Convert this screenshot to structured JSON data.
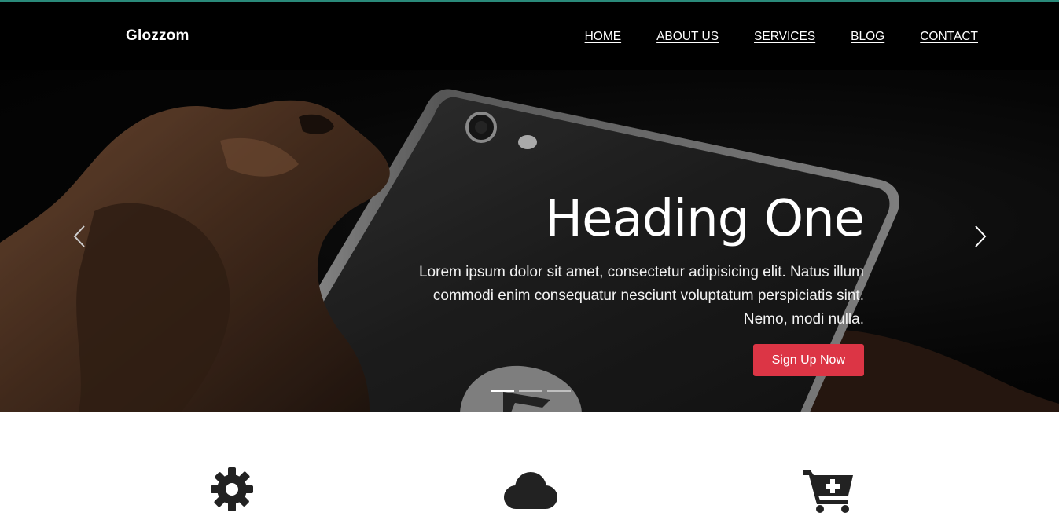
{
  "navbar": {
    "brand": "Glozzom",
    "links": [
      "HOME",
      "ABOUT US",
      "SERVICES",
      "BLOG",
      "CONTACT"
    ]
  },
  "hero": {
    "heading": "Heading One",
    "text_lines": [
      "Lorem ipsum dolor sit amet, consectetur adipisicing elit. Natus illum",
      "commodi enim consequatur nesciunt voluptatum perspiciatis sint.",
      "Nemo, modi nulla."
    ],
    "button_label": "Sign Up Now",
    "slide_count": 3,
    "active_slide": 1
  },
  "features": {
    "icons": [
      "gear-icon",
      "cloud-icon",
      "cart-plus-icon"
    ]
  },
  "colors": {
    "navbar_bg": "#000000",
    "accent_line": "#2a8a7a",
    "button": "#dc3545",
    "icon": "#222222"
  }
}
